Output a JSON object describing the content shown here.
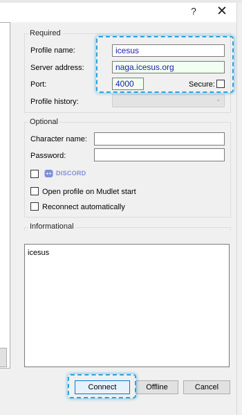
{
  "window": {
    "help_label": "?",
    "close_label": "✕"
  },
  "required": {
    "title": "Required",
    "profile_name_label": "Profile name:",
    "profile_name_value": "icesus",
    "server_address_label": "Server address:",
    "server_address_value": "naga.icesus.org",
    "port_label": "Port:",
    "port_value": "4000",
    "secure_label": "Secure:",
    "secure_checked": false,
    "profile_history_label": "Profile history:",
    "profile_history_value": ""
  },
  "optional": {
    "title": "Optional",
    "character_name_label": "Character name:",
    "character_name_value": "",
    "password_label": "Password:",
    "password_value": "",
    "discord_label": "DISCORD",
    "discord_checked": false,
    "open_on_start_label": "Open profile on Mudlet start",
    "open_on_start_checked": false,
    "reconnect_label": "Reconnect automatically",
    "reconnect_checked": false
  },
  "informational": {
    "title": "Informational",
    "text": "icesus"
  },
  "buttons": {
    "connect": "Connect",
    "offline": "Offline",
    "cancel": "Cancel"
  },
  "colors": {
    "highlight": "#2aa3e0",
    "field_text": "#1b1bb3",
    "discord": "#7f8fd9"
  }
}
